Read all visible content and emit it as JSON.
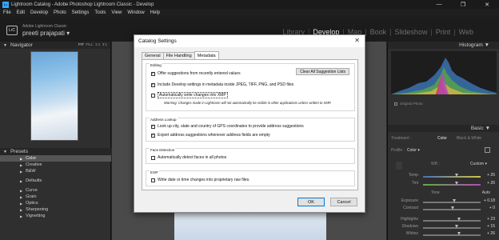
{
  "window": {
    "title": "Lightroom Catalog - Adobe Photoshop Lightroom Classic - Develop",
    "app_icon": "Lr",
    "controls": [
      "—",
      "❐",
      "✕"
    ]
  },
  "menu": [
    "File",
    "Edit",
    "Develop",
    "Photo",
    "Settings",
    "Tools",
    "View",
    "Window",
    "Help"
  ],
  "identity": {
    "badge": "LrC",
    "subtitle": "Adobe Lightroom Classic",
    "user": "preeti prajapati",
    "user_caret": "▾"
  },
  "modules": [
    "Library",
    "Develop",
    "Map",
    "Book",
    "Slideshow",
    "Print",
    "Web"
  ],
  "active_module": "Develop",
  "left_panel": {
    "navigator_title": "Navigator",
    "nav_modes": [
      "FIT",
      "FILL",
      "1:1",
      "3:1"
    ],
    "presets_title": "Presets",
    "presets": [
      {
        "label": "Color",
        "selected": true
      },
      {
        "label": "Creative",
        "selected": false
      },
      {
        "label": "B&W",
        "selected": false
      },
      {
        "label": "Defaults",
        "selected": false
      },
      {
        "label": "Curve",
        "selected": false
      },
      {
        "label": "Grain",
        "selected": false
      },
      {
        "label": "Optics",
        "selected": false
      },
      {
        "label": "Sharpening",
        "selected": false
      },
      {
        "label": "Vignetting",
        "selected": false
      }
    ]
  },
  "right_panel": {
    "histogram_title": "Histogram",
    "original_photo": "Original Photo",
    "basic_title": "Basic",
    "treatment_label": "Treatment :",
    "treatment_color": "Color",
    "treatment_bw": "Black & White",
    "profile_label": "Profile :",
    "profile_value": "Color",
    "wb_label": "WB :",
    "wb_value": "Custom",
    "temp": {
      "label": "Temp",
      "value": "+ 26"
    },
    "tint": {
      "label": "Tint",
      "value": "+ 26"
    },
    "tone_label": "Tone",
    "tone_auto": "Auto",
    "exposure": {
      "label": "Exposure",
      "value": "+ 0.18"
    },
    "contrast": {
      "label": "Contrast",
      "value": "+ 0"
    },
    "highlights": {
      "label": "Highlights",
      "value": "+ 23"
    },
    "shadows": {
      "label": "Shadows",
      "value": "+ 15"
    },
    "whites": {
      "label": "Whites",
      "value": "+ 26"
    }
  },
  "dialog": {
    "title": "Catalog Settings",
    "close": "✕",
    "tabs": [
      "General",
      "File Handling",
      "Metadata"
    ],
    "active_tab": "Metadata",
    "editing": {
      "title": "Editing",
      "offer_suggestions": {
        "label": "Offer suggestions from recently entered values",
        "checked": true
      },
      "clear_button": "Clear All Suggestion Lists",
      "include_develop": {
        "label": "Include Develop settings in metadata inside JPEG, TIFF, PNG, and PSD files",
        "checked": true
      },
      "auto_write_xmp": {
        "label": "Automatically write changes into XMP",
        "checked": false
      },
      "warning": "Warning: Changes made in Lightroom will not automatically be visible in other applications unless written to XMP."
    },
    "address_lookup": {
      "title": "Address Lookup",
      "lookup_city": {
        "label": "Look up city, state and country of GPS coordinates to provide address suggestions",
        "checked": true
      },
      "export_suggestions": {
        "label": "Export address suggestions whenever address fields are empty",
        "checked": true
      }
    },
    "face_detection": {
      "title": "Face Detection",
      "auto_detect": {
        "label": "Automatically detect faces in all photos",
        "checked": false
      }
    },
    "exif": {
      "title": "EXIF",
      "write_date": {
        "label": "Write date or time changes into proprietary raw files.",
        "checked": false
      }
    },
    "ok": "OK",
    "cancel": "Cancel"
  }
}
